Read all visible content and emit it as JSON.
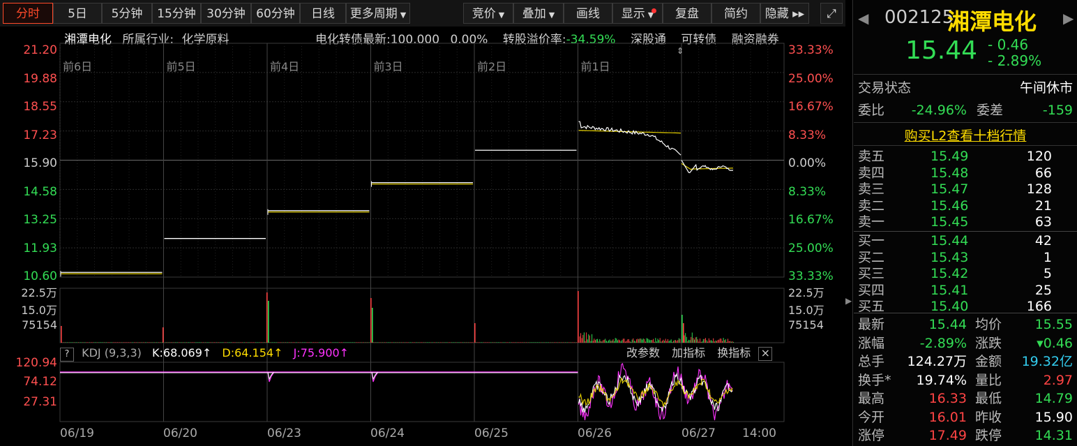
{
  "toolbar": {
    "left": [
      {
        "label": "分时",
        "active": true
      },
      {
        "label": "5日"
      },
      {
        "label": "5分钟"
      },
      {
        "label": "15分钟"
      },
      {
        "label": "30分钟"
      },
      {
        "label": "60分钟"
      },
      {
        "label": "日线"
      },
      {
        "label": "更多周期",
        "dropdown": true
      }
    ],
    "right": [
      {
        "label": "竞价",
        "dropdown": true
      },
      {
        "label": "叠加",
        "dropdown": true
      },
      {
        "label": "画线"
      },
      {
        "label": "显示",
        "dropdown": true,
        "dot": true
      },
      {
        "label": "复盘"
      },
      {
        "label": "简约"
      },
      {
        "label": "隐藏 ▸▸"
      }
    ]
  },
  "info": {
    "name": "湘潭电化",
    "industry_label": "所属行业:",
    "industry": "化学原料",
    "bond_label": "电化转债最新:",
    "bond_price": "100.000",
    "bond_change": "0.00%",
    "premium_label": "转股溢价率:",
    "premium": "-34.59%",
    "links": [
      "深股通",
      "可转债",
      "融资融券"
    ]
  },
  "price_axis": {
    "left": [
      "21.20",
      "19.88",
      "18.55",
      "17.23",
      "15.90",
      "14.58",
      "13.25",
      "11.93",
      "10.60"
    ],
    "right": [
      "33.33%",
      "25.00%",
      "16.67%",
      "8.33%",
      "0.00%",
      "8.33%",
      "16.67%",
      "25.00%",
      "33.33%"
    ]
  },
  "day_labels": [
    "前6日",
    "前5日",
    "前4日",
    "前3日",
    "前2日",
    "前1日"
  ],
  "volume_axis": {
    "left": [
      "22.5万",
      "15.0万",
      "75154"
    ],
    "right": [
      "22.5万",
      "15.0万",
      "75154"
    ]
  },
  "kdj": {
    "help": "?",
    "name": "KDJ (9,3,3)",
    "k": "K:68.069↑",
    "d": "D:64.154↑",
    "j": "J:75.900↑",
    "actions": [
      "改参数",
      "加指标",
      "换指标"
    ],
    "close": "×",
    "axis": [
      "120.94",
      "74.12",
      "27.31"
    ]
  },
  "dates": [
    "06/19",
    "06/20",
    "06/23",
    "06/24",
    "06/25",
    "06/26",
    "06/27",
    "14:00"
  ],
  "stock": {
    "code": "002125",
    "name": "湘潭电化",
    "price": "15.44",
    "change": "- 0.46",
    "change_pct": "- 2.89%",
    "trade_status_label": "交易状态",
    "trade_status": "午间休市",
    "weibi_label": "委比",
    "weibi": "-24.96%",
    "weicha_label": "委差",
    "weicha": "-159",
    "l2_link": "购买L2查看十档行情"
  },
  "asks": [
    {
      "label": "卖五",
      "price": "15.49",
      "vol": "120"
    },
    {
      "label": "卖四",
      "price": "15.48",
      "vol": "66"
    },
    {
      "label": "卖三",
      "price": "15.47",
      "vol": "128"
    },
    {
      "label": "卖二",
      "price": "15.46",
      "vol": "21"
    },
    {
      "label": "卖一",
      "price": "15.45",
      "vol": "63"
    }
  ],
  "bids": [
    {
      "label": "买一",
      "price": "15.44",
      "vol": "42"
    },
    {
      "label": "买二",
      "price": "15.43",
      "vol": "1"
    },
    {
      "label": "买三",
      "price": "15.42",
      "vol": "5"
    },
    {
      "label": "买四",
      "price": "15.41",
      "vol": "25"
    },
    {
      "label": "买五",
      "price": "15.40",
      "vol": "166"
    }
  ],
  "stats": [
    {
      "l1": "最新",
      "v1": "15.44",
      "c1": "g",
      "l2": "均价",
      "v2": "15.55",
      "c2": "g"
    },
    {
      "l1": "涨幅",
      "v1": "-2.89%",
      "c1": "g",
      "l2": "涨跌",
      "v2": "▾0.46",
      "c2": "g"
    },
    {
      "l1": "总手",
      "v1": "124.27万",
      "c1": "w",
      "l2": "金额",
      "v2": "19.32亿",
      "c2": "cy"
    },
    {
      "l1": "换手*",
      "v1": "19.74%",
      "c1": "w",
      "l2": "量比",
      "v2": "2.97",
      "c2": "r"
    },
    {
      "l1": "最高",
      "v1": "16.33",
      "c1": "r",
      "l2": "最低",
      "v2": "14.79",
      "c2": "g"
    },
    {
      "l1": "今开",
      "v1": "16.01",
      "c1": "r",
      "l2": "昨收",
      "v2": "15.90",
      "c2": "w"
    },
    {
      "l1": "涨停",
      "v1": "17.49",
      "c1": "r",
      "l2": "跌停",
      "v2": "14.31",
      "c2": "g"
    }
  ],
  "chart_data": {
    "type": "line",
    "title": "",
    "ylim": [
      10.6,
      21.2
    ],
    "days": [
      "06/19",
      "06/20",
      "06/23",
      "06/24",
      "06/25",
      "06/26",
      "06/27"
    ],
    "series": [
      {
        "values": [
          10.75,
          12.35,
          13.55,
          14.82,
          16.35,
          17.05,
          15.44
        ]
      }
    ]
  }
}
